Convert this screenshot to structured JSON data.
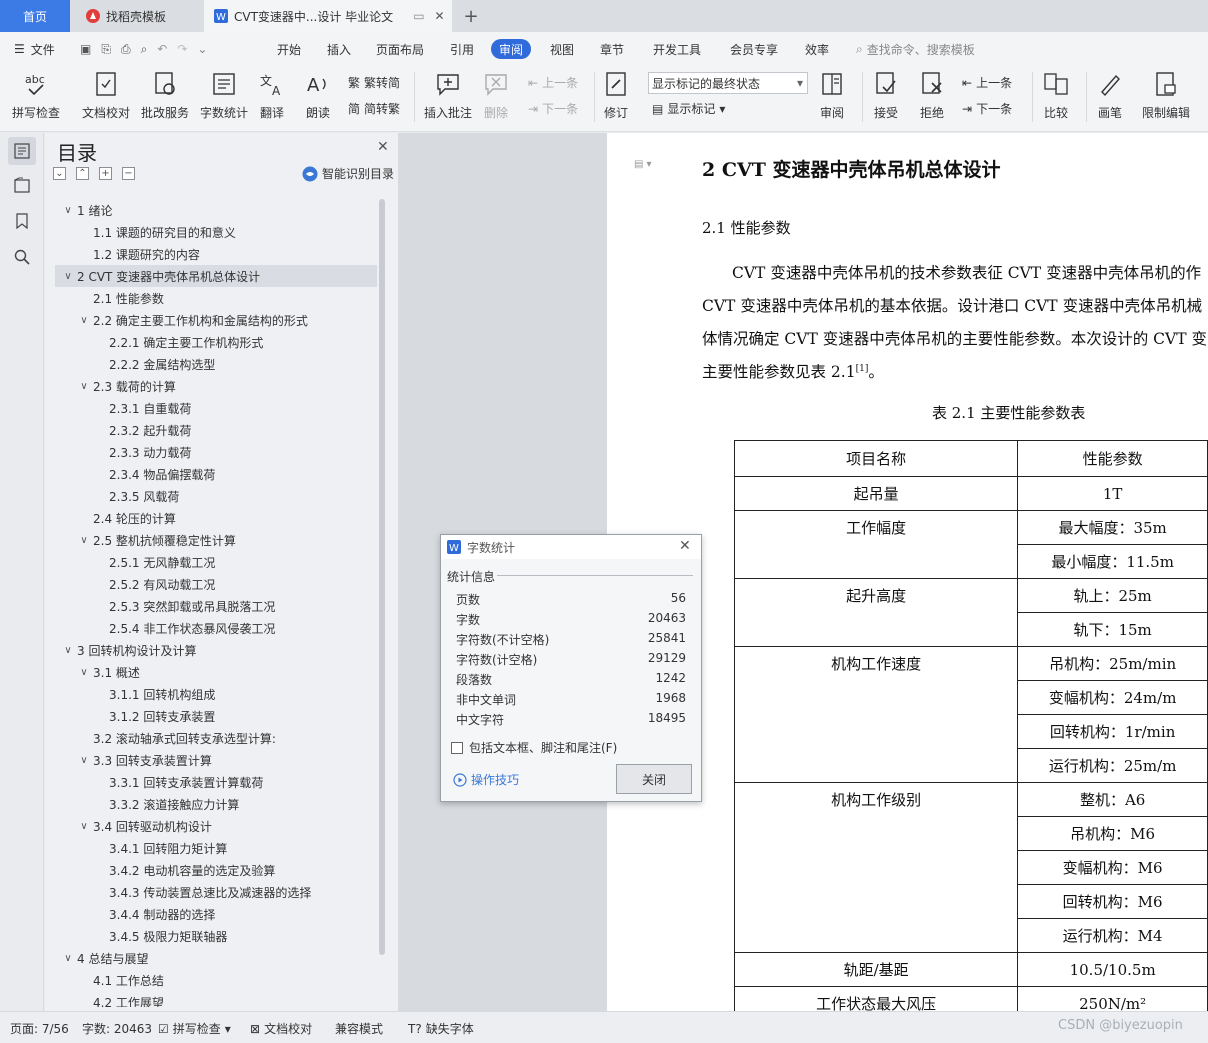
{
  "tabs": {
    "home": "首页",
    "daoke": "找稻壳模板",
    "doc": "CVT变速器中...设计 毕业论文",
    "add": "+"
  },
  "menu": {
    "file": "文件",
    "items": [
      "开始",
      "插入",
      "页面布局",
      "引用",
      "审阅",
      "视图",
      "章节",
      "开发工具",
      "会员专享",
      "效率"
    ],
    "search": "查找命令、搜索模板",
    "active": "审阅"
  },
  "ribbon": {
    "spell": "拼写检查",
    "proof": "文档校对",
    "correct": "批改服务",
    "wordcount": "字数统计",
    "translate": "翻译",
    "read": "朗读",
    "trad": "繁转简",
    "simp": "简转繁",
    "insert_comment": "插入批注",
    "delete": "删除",
    "prev": "上一条",
    "next": "下一条",
    "track": "修订",
    "show_select": "显示标记的最终状态",
    "show_marks": "显示标记",
    "review": "审阅",
    "accept": "接受",
    "reject": "拒绝",
    "prev2": "上一条",
    "next2": "下一条",
    "compare": "比较",
    "pen": "画笔",
    "restrict": "限制编辑"
  },
  "toc": {
    "title": "目录",
    "smart": "智能识别目录",
    "items": [
      {
        "level": 1,
        "text": "1  绪论",
        "expanded": true
      },
      {
        "level": 2,
        "text": "1.1  课题的研究目的和意义"
      },
      {
        "level": 2,
        "text": "1.2  课题研究的内容"
      },
      {
        "level": 1,
        "text": "2  CVT 变速器中壳体吊机总体设计",
        "expanded": true,
        "selected": true
      },
      {
        "level": 2,
        "text": "2.1  性能参数"
      },
      {
        "level": 2,
        "text": "2.2  确定主要工作机构和金属结构的形式",
        "expanded": true
      },
      {
        "level": 3,
        "text": "2.2.1  确定主要工作机构形式"
      },
      {
        "level": 3,
        "text": "2.2.2  金属结构选型"
      },
      {
        "level": 2,
        "text": "2.3  载荷的计算",
        "expanded": true
      },
      {
        "level": 3,
        "text": "2.3.1  自重载荷"
      },
      {
        "level": 3,
        "text": "2.3.2  起升载荷"
      },
      {
        "level": 3,
        "text": "2.3.3  动力载荷"
      },
      {
        "level": 3,
        "text": "2.3.4  物品偏摆载荷"
      },
      {
        "level": 3,
        "text": "2.3.5  风载荷"
      },
      {
        "level": 2,
        "text": "2.4  轮压的计算"
      },
      {
        "level": 2,
        "text": "2.5  整机抗倾覆稳定性计算",
        "expanded": true
      },
      {
        "level": 3,
        "text": "2.5.1  无风静载工况"
      },
      {
        "level": 3,
        "text": "2.5.2  有风动载工况"
      },
      {
        "level": 3,
        "text": "2.5.3  突然卸载或吊具脱落工况"
      },
      {
        "level": 3,
        "text": "2.5.4  非工作状态暴风侵袭工况"
      },
      {
        "level": 1,
        "text": "3  回转机构设计及计算",
        "expanded": true
      },
      {
        "level": 2,
        "text": "3.1  概述",
        "expanded": true
      },
      {
        "level": 3,
        "text": "3.1.1  回转机构组成"
      },
      {
        "level": 3,
        "text": "3.1.2  回转支承装置"
      },
      {
        "level": 2,
        "text": "3.2  滚动轴承式回转支承选型计算:"
      },
      {
        "level": 2,
        "text": "3.3  回转支承装置计算",
        "expanded": true
      },
      {
        "level": 3,
        "text": "3.3.1  回转支承装置计算载荷"
      },
      {
        "level": 3,
        "text": "3.3.2  滚道接触应力计算"
      },
      {
        "level": 2,
        "text": "3.4  回转驱动机构设计",
        "expanded": true
      },
      {
        "level": 3,
        "text": "3.4.1  回转阻力矩计算"
      },
      {
        "level": 3,
        "text": "3.4.2  电动机容量的选定及验算"
      },
      {
        "level": 3,
        "text": "3.4.3  传动装置总速比及减速器的选择"
      },
      {
        "level": 3,
        "text": "3.4.4  制动器的选择"
      },
      {
        "level": 3,
        "text": "3.4.5  极限力矩联轴器"
      },
      {
        "level": 1,
        "text": "4  总结与展望",
        "expanded": true
      },
      {
        "level": 2,
        "text": "4.1  工作总结"
      },
      {
        "level": 2,
        "text": "4.2  工作展望"
      }
    ]
  },
  "doc": {
    "heading": "2 CVT 变速器中壳体吊机总体设计",
    "subheading": "2.1  性能参数",
    "lines": [
      "CVT 变速器中壳体吊机的技术参数表征 CVT 变速器中壳体吊机的作",
      "CVT 变速器中壳体吊机的基本依据。设计港口 CVT 变速器中壳体吊机械",
      "体情况确定 CVT 变速器中壳体吊机的主要性能参数。本次设计的 CVT 变",
      "主要性能参数见表 2.1"
    ],
    "cite": "[1]",
    "period": "。",
    "table_caption": "表 2.1  主要性能参数表",
    "table": {
      "headers": [
        "项目名称",
        "性能参数"
      ],
      "groups": [
        {
          "name": "起吊量",
          "values": [
            "1T"
          ]
        },
        {
          "name": "工作幅度",
          "values": [
            "最大幅度：35m",
            "最小幅度：11.5m"
          ]
        },
        {
          "name": "起升高度",
          "values": [
            "轨上：25m",
            "轨下：15m"
          ]
        },
        {
          "name": "机构工作速度",
          "values": [
            "吊机构：25m/min",
            "变幅机构：24m/m",
            "回转机构：1r/min",
            "运行机构：25m/m"
          ]
        },
        {
          "name": "机构工作级别",
          "values": [
            "整机：A6",
            "吊机构：M6",
            "变幅机构：M6",
            "回转机构：M6",
            "运行机构：M4"
          ]
        },
        {
          "name": "轨距/基距",
          "values": [
            "10.5/10.5m"
          ]
        },
        {
          "name": "工作状态最大风压",
          "values": [
            "250N/m²"
          ]
        }
      ]
    }
  },
  "dialog": {
    "title": "字数统计",
    "section": "统计信息",
    "rows": [
      {
        "label": "页数",
        "value": "56"
      },
      {
        "label": "字数",
        "value": "20463"
      },
      {
        "label": "字符数(不计空格)",
        "value": "25841"
      },
      {
        "label": "字符数(计空格)",
        "value": "29129"
      },
      {
        "label": "段落数",
        "value": "1242"
      },
      {
        "label": "非中文单词",
        "value": "1968"
      },
      {
        "label": "中文字符",
        "value": "18495"
      }
    ],
    "checkbox": "包括文本框、脚注和尾注(F)",
    "tips": "操作技巧",
    "close": "关闭"
  },
  "status": {
    "page": "页面: 7/56",
    "words": "字数: 20463",
    "spell": "拼写检查",
    "proof": "文档校对",
    "compat": "兼容模式",
    "font": "缺失字体",
    "watermark": "CSDN @biyezuopin"
  },
  "colors": {
    "accent": "#2f6bdb",
    "tab_active": "#3c7be6",
    "link": "#3a78d6"
  }
}
